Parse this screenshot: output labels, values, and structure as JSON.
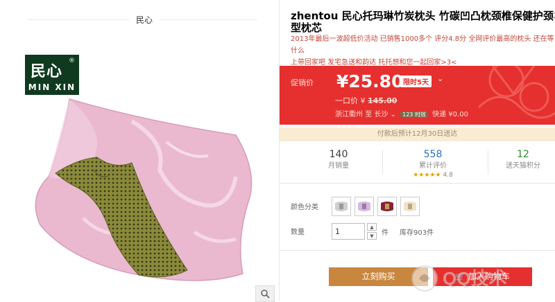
{
  "gallery": {
    "brand_title": "民心",
    "logo_cn": "民心",
    "logo_reg": "®",
    "logo_en": "MIN XIN"
  },
  "product": {
    "title_line1": "zhentou 民心托玛琳竹炭枕头 竹碳凹凸枕颈椎保健护颈枕",
    "title_line2": "型枕芯",
    "subtitle_line1": "2013年最后一波超低价活动 已销售1000多个 评分4.8分 全网评价最高的枕头 还在等什么",
    "subtitle_line2": "上带回家吧 发宅急送和韵达 托托想和您一起回家>3<"
  },
  "price": {
    "label": "促销价",
    "value": "¥25.80",
    "tag": "限时5天",
    "orig_prefix": "一口价 ¥",
    "orig_value": "145.00",
    "ship_from": "浙江衢州",
    "ship_to_word": "至",
    "ship_to": "长沙",
    "ship_chip": "123 时效",
    "ship_fee": "快递 ¥0.00"
  },
  "notice": "付款后预计12月30日送达",
  "stats": [
    {
      "num": "140",
      "label": "月销量",
      "color": "#3c3c3c"
    },
    {
      "num": "558",
      "label": "累计评价",
      "color": "#2a73b8",
      "rating": "4.8",
      "stars": "★★★★★"
    },
    {
      "num": "12",
      "label": "送天猫积分",
      "color": "#2a8a2a"
    }
  ],
  "sku": {
    "color_label": "颜色分类",
    "swatches": [
      "gray",
      "lavender",
      "wine",
      "cream"
    ],
    "qty_label": "数量",
    "qty_value": "1",
    "qty_unit": "件",
    "stock": "库存903件"
  },
  "actions": {
    "buy": "立刻购买",
    "cart": "加入购物车"
  },
  "watermark": "QQ技术",
  "colors": {
    "accent": "#e5302f",
    "buy": "#c9863f",
    "notice_bg": "#f9ecd2",
    "logo_bg": "#0f3a1f"
  }
}
